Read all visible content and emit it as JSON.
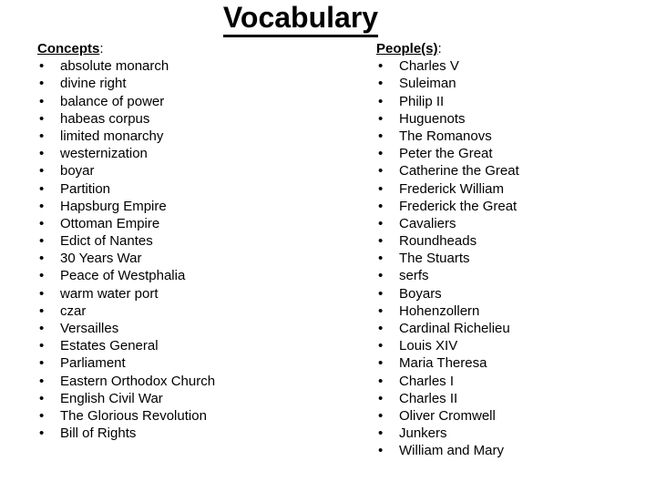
{
  "slide": {
    "title": "Vocabulary",
    "bullet_glyph": "•",
    "text_color": "#000000",
    "background_color": "#ffffff",
    "columns": [
      {
        "heading_word": "Concepts",
        "heading_colon": ":",
        "items": [
          "absolute monarch",
          "divine right",
          "balance of power",
          "habeas corpus",
          "limited monarchy",
          "westernization",
          "boyar",
          "Partition",
          "Hapsburg Empire",
          "Ottoman Empire",
          "Edict of Nantes",
          "30 Years War",
          "Peace of Westphalia",
          "warm water port",
          "czar",
          "Versailles",
          "Estates General",
          "Parliament",
          "Eastern Orthodox Church",
          "English Civil War",
          "The Glorious Revolution",
          "Bill of Rights"
        ]
      },
      {
        "heading_word": "People(s)",
        "heading_colon": ":",
        "items": [
          "Charles V",
          "Suleiman",
          "Philip II",
          "Huguenots",
          "The Romanovs",
          "Peter the Great",
          "Catherine the Great",
          "Frederick William",
          "Frederick the Great",
          "Cavaliers",
          "Roundheads",
          "The Stuarts",
          "serfs",
          "Boyars",
          "Hohenzollern",
          "Cardinal Richelieu",
          "Louis XIV",
          "Maria Theresa",
          "Charles I",
          "Charles II",
          "Oliver Cromwell",
          "Junkers",
          "William and Mary"
        ]
      }
    ]
  }
}
